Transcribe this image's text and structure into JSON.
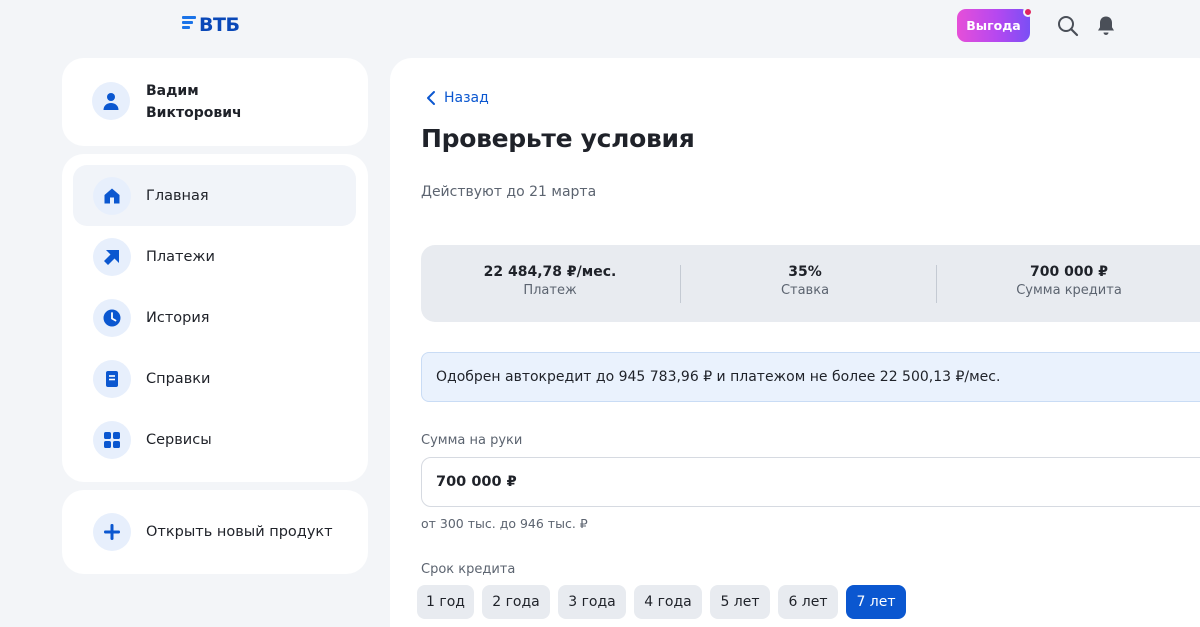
{
  "header": {
    "logo": "ВТБ",
    "promo_label": "Выгода"
  },
  "profile": {
    "first_name": "Вадим",
    "patronymic": "Викторович"
  },
  "sidebar": {
    "items": [
      {
        "label": "Главная",
        "icon": "home-icon",
        "active": true
      },
      {
        "label": "Платежи",
        "icon": "payment-arrow-icon",
        "active": false
      },
      {
        "label": "История",
        "icon": "clock-icon",
        "active": false
      },
      {
        "label": "Справки",
        "icon": "document-icon",
        "active": false
      },
      {
        "label": "Сервисы",
        "icon": "grid-icon",
        "active": false
      }
    ],
    "new_product": "Открыть новый продукт"
  },
  "main": {
    "back_label": "Назад",
    "title": "Проверьте условия",
    "valid_until": "Действуют до 21 марта",
    "summary": [
      {
        "value": "22 484,78 ₽/мес.",
        "label": "Платеж"
      },
      {
        "value": "35%",
        "label": "Ставка"
      },
      {
        "value": "700 000 ₽",
        "label": "Сумма кредита"
      }
    ],
    "notice": "Одобрен автокредит до 945 783,96 ₽ и платежом не более 22 500,13 ₽/мес.",
    "amount_label": "Сумма на руки",
    "amount_value": "700 000 ₽",
    "amount_hint": "от 300 тыс. до 946 тыс. ₽",
    "term_label": "Срок кредита",
    "terms": [
      "1 год",
      "2 года",
      "3 года",
      "4 года",
      "5 лет",
      "6 лет",
      "7 лет"
    ],
    "selected_term": "7 лет"
  },
  "colors": {
    "accent": "#0b57d0",
    "icon_bg": "#e7effc",
    "notice_bg": "#eaf2fd"
  }
}
